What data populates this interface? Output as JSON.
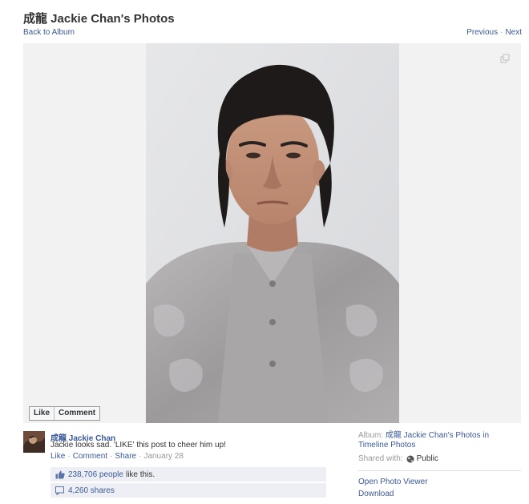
{
  "header": {
    "title": "成龍 Jackie Chan's Photos",
    "back_link": "Back to Album",
    "previous": "Previous",
    "separator": "·",
    "next": "Next"
  },
  "stage": {
    "expand_icon": "expand-icon",
    "like_button": "Like",
    "comment_button": "Comment"
  },
  "post": {
    "owner": "成龍 Jackie Chan",
    "caption": "Jackie looks sad. 'LIKE' this post to cheer him up!",
    "actions": {
      "like": "Like",
      "comment": "Comment",
      "share": "Share",
      "sep": "·",
      "date": "January 28"
    },
    "likes": {
      "count": "238,706 people",
      "suffix": "like this.",
      "icon": "thumbs-up-icon"
    },
    "shares": {
      "count": "4,260 shares",
      "icon": "share-icon"
    }
  },
  "sidebar": {
    "album_label": "Album:",
    "album_name": "成龍 Jackie Chan's Photos in Timeline Photos",
    "shared_label": "Shared with:",
    "audience": "Public",
    "audience_icon": "globe-icon",
    "open_viewer": "Open Photo Viewer",
    "download": "Download"
  }
}
